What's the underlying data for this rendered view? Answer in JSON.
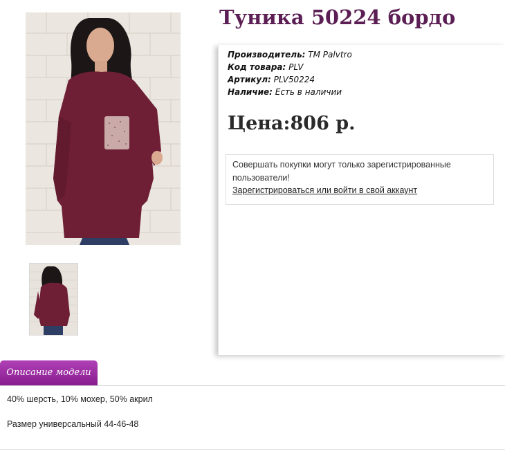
{
  "product": {
    "title": "Туника 50224 бордо",
    "manufacturer_label": "Производитель:",
    "manufacturer_value": "ТМ Palvtro",
    "code_label": "Код товара:",
    "code_value": "PLV",
    "article_label": "Артикул:",
    "article_value": "PLV50224",
    "availability_label": "Наличие:",
    "availability_value": "Есть в наличии",
    "price": "Цена:806 р."
  },
  "notice": {
    "text": "Совершать покупки могут только зарегистрированные пользователи!",
    "link": "Зарегистрироваться или войти в свой аккаунт"
  },
  "tabs": {
    "description_label": "Описание модели"
  },
  "description": {
    "line1": "40% шерсть, 10% мохер, 50% акрил",
    "line2": "Размер универсальный 44-46-48"
  },
  "colors": {
    "title": "#5c1f55",
    "tab": "#a12ba8",
    "garment": "#6e1f35"
  }
}
